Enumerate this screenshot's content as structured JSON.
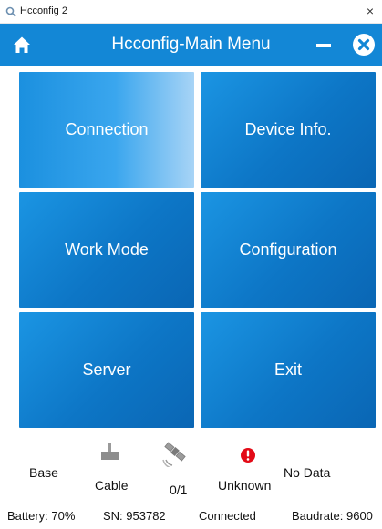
{
  "window": {
    "title": "Hcconfig 2",
    "close_glyph": "×"
  },
  "header": {
    "title": "Hcconfig-Main Menu",
    "accent_color": "#1387d6"
  },
  "menu": {
    "connection": "Connection",
    "device_info": "Device Info.",
    "work_mode": "Work Mode",
    "configuration": "Configuration",
    "server": "Server",
    "exit": "Exit"
  },
  "status": {
    "mode": "Base",
    "link": "Cable",
    "satellites": "0/1",
    "alert": "Unknown",
    "data": "No Data"
  },
  "statusbar": {
    "battery": "Battery: 70%",
    "sn": "SN: 953782",
    "connection": "Connected",
    "baudrate": "Baudrate: 9600"
  },
  "icons": [
    "app-icon",
    "home-icon",
    "minimize-icon",
    "close-circle-icon",
    "cable-icon",
    "satellite-icon",
    "alert-icon"
  ]
}
